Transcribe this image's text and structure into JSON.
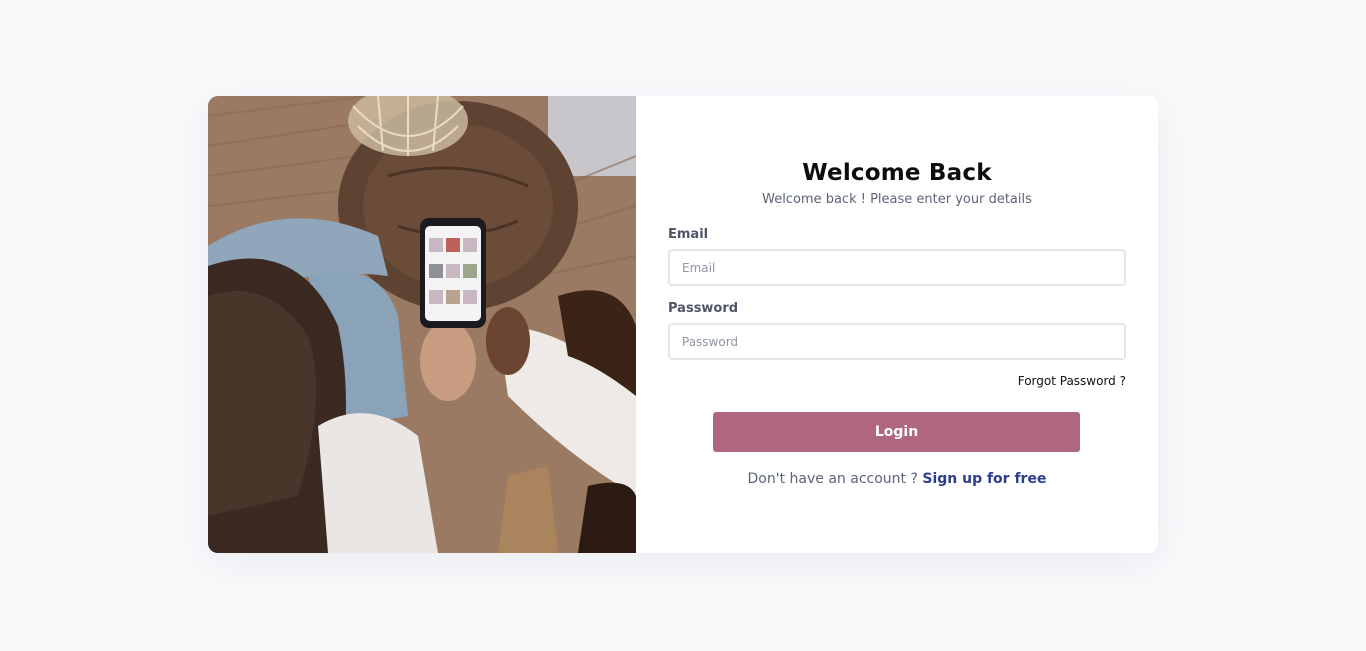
{
  "login": {
    "title": "Welcome Back",
    "subtitle": "Welcome back ! Please enter your details",
    "email_label": "Email",
    "email_placeholder": "Email",
    "password_label": "Password",
    "password_placeholder": "Password",
    "forgot_label": "Forgot Password ?",
    "login_label": "Login",
    "signup_prompt": "Don't have an account ?",
    "signup_link": "Sign up for free"
  },
  "colors": {
    "page_background": "#f8f9fb",
    "panel_background": "#ffffff",
    "button_accent": "#b0677d",
    "link_accent": "#2c3d92"
  },
  "image": {
    "subject": "people-using-phone-photo"
  }
}
